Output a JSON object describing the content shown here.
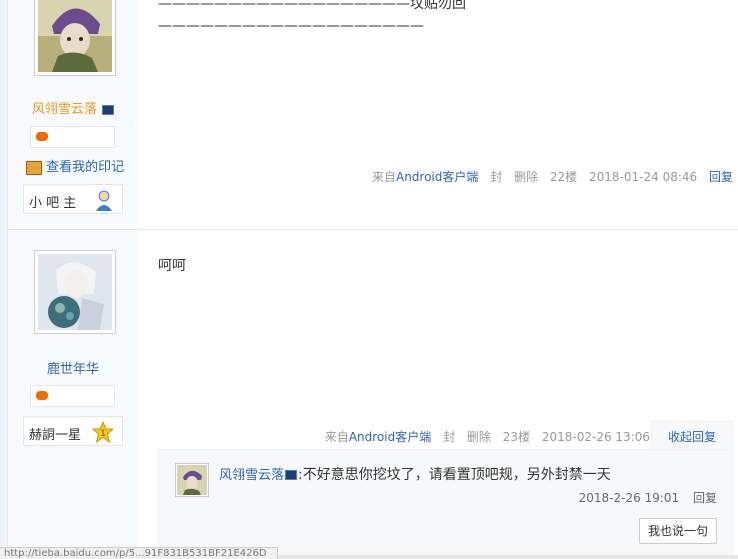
{
  "post1": {
    "author": "风翎雪云落",
    "mark_link": "查看我的印记",
    "badge_label": "小 吧 主",
    "content_lines": [
      "——————————————————坟贴勿回",
      "———————————————————"
    ],
    "tail": {
      "client_prefix": "来自",
      "client_link": "Android客户端",
      "ban": "封",
      "delete": "删除",
      "floor": "22楼",
      "time": "2018-01-24 08:46",
      "reply": "回复"
    }
  },
  "post2": {
    "author": "鹿世年华",
    "badge_label": "赫詷一星",
    "badge_level": "1",
    "content": "呵呵",
    "tail": {
      "client_prefix": "来自",
      "client_link": "Android客户端",
      "ban": "封",
      "delete": "删除",
      "floor": "23楼",
      "time": "2018-02-26 13:06"
    },
    "collapse_reply": "收起回复",
    "sub_reply": {
      "author": "风翎雪云落",
      "text": ":不好意思你挖坟了，请看置顶吧规，另外封禁一天",
      "time": "2018-2-26 19:01",
      "reply": "回复"
    },
    "say_button": "我也说一句"
  },
  "status_bar": "http://tieba.baidu.com/p/5...91F831B531BF21E426D"
}
